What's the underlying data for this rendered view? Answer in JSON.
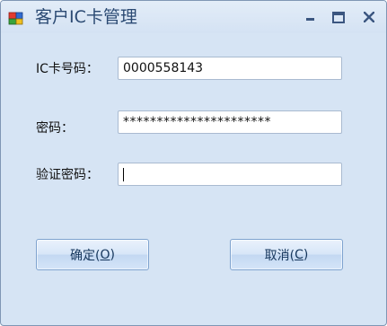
{
  "window": {
    "title": "客户IC卡管理",
    "minimize_icon": "minimize-icon",
    "maximize_icon": "maximize-icon",
    "close_icon": "close-icon",
    "app_icon": "app-icon"
  },
  "form": {
    "card_label": "IC卡号码：",
    "card_value": "0000558143",
    "password_label": "密码：",
    "password_value": "**********************",
    "confirm_label": "验证密码：",
    "confirm_value": ""
  },
  "buttons": {
    "ok": {
      "text": "确定(",
      "key": "O",
      "close": ")"
    },
    "cancel": {
      "text": "取消(",
      "key": "C",
      "close": ")"
    }
  },
  "colors": {
    "window_bg": "#d6e4f4",
    "title_text": "#2b4a73",
    "button_text": "#15365c"
  }
}
